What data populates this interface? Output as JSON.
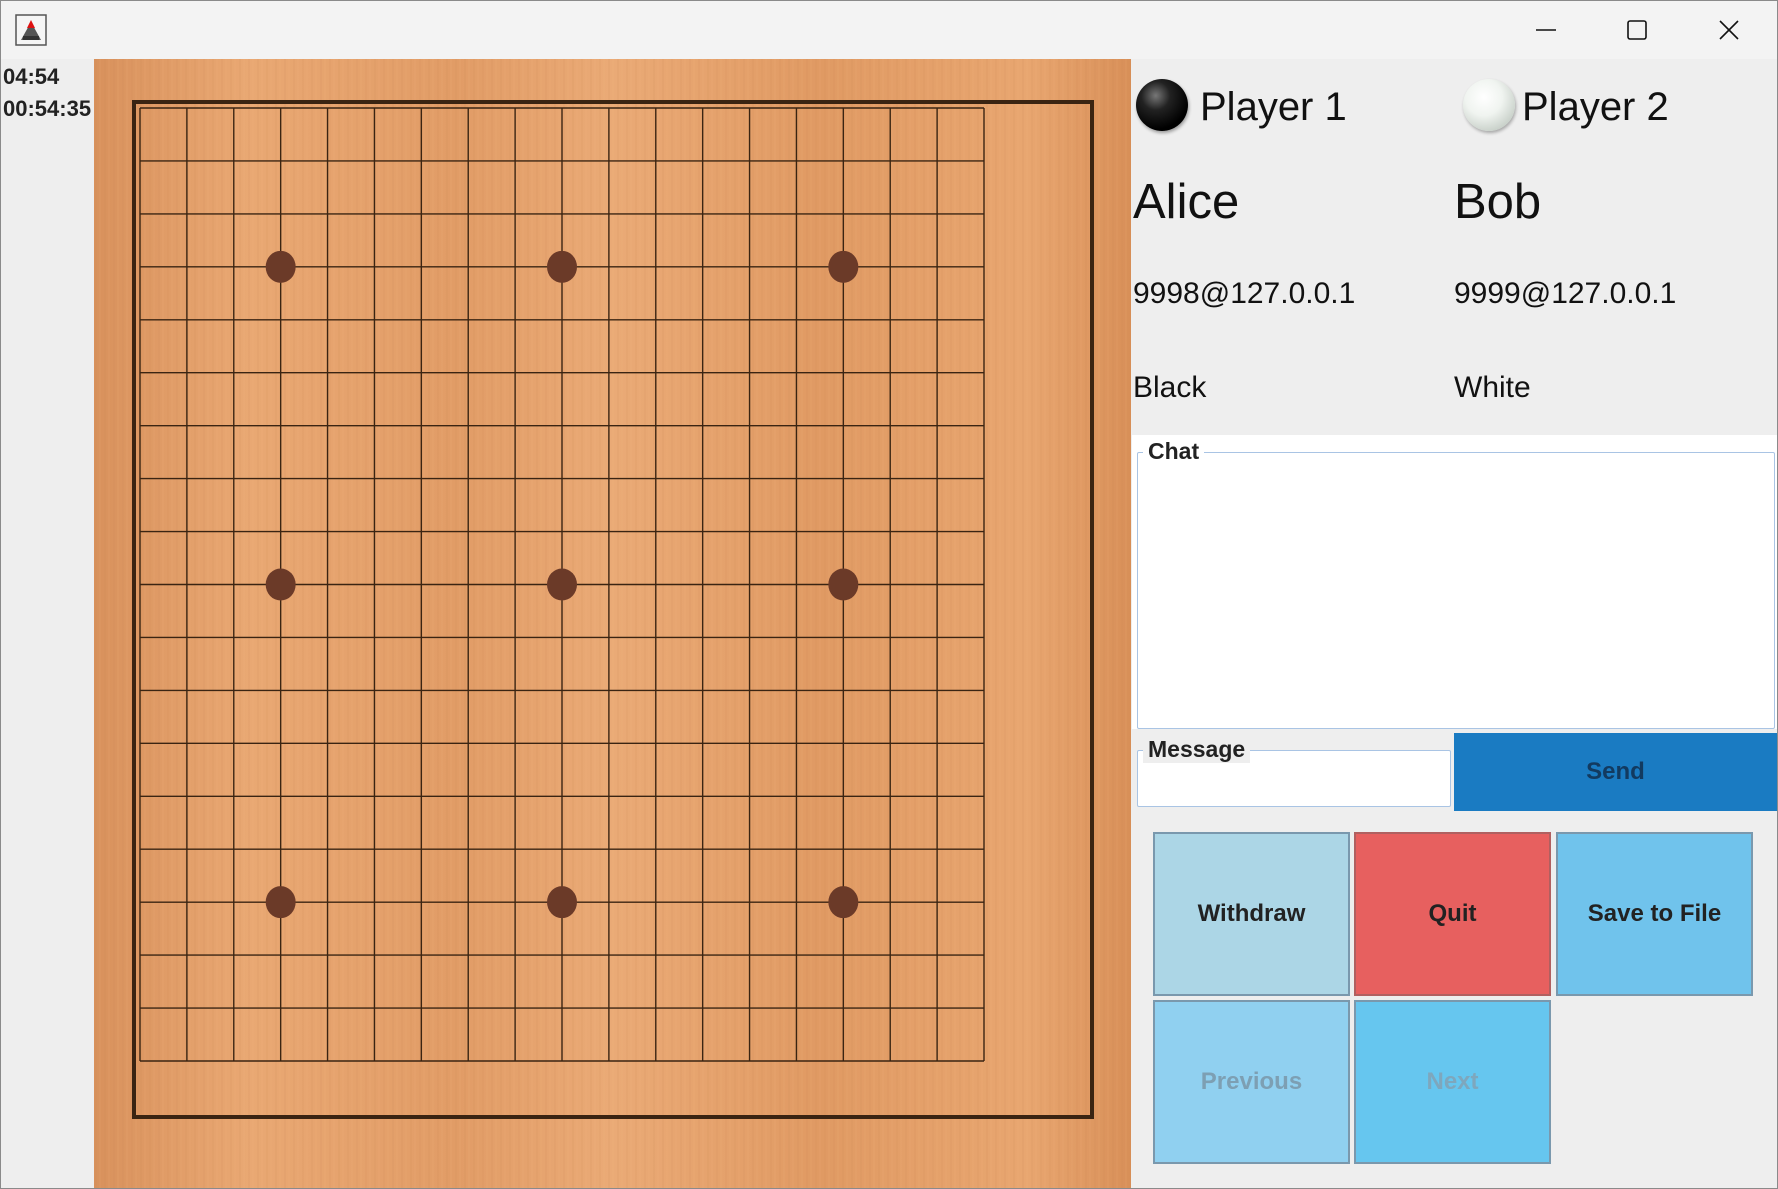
{
  "timers": {
    "move_time": "04:54",
    "total_time": "00:54:35"
  },
  "window_controls": {
    "minimize_icon": "minimize-icon",
    "maximize_icon": "maximize-icon",
    "close_icon": "close-icon",
    "app_icon": "java-app-icon"
  },
  "board": {
    "size": 19,
    "star_points": [
      [
        3,
        3
      ],
      [
        3,
        9
      ],
      [
        3,
        15
      ],
      [
        9,
        3
      ],
      [
        9,
        9
      ],
      [
        9,
        15
      ],
      [
        15,
        3
      ],
      [
        15,
        9
      ],
      [
        15,
        15
      ]
    ],
    "stones": [],
    "colors": {
      "wood": "#e5a26c",
      "line": "#3a2412",
      "star": "#6b3a28"
    }
  },
  "players": {
    "player1": {
      "label": "Player 1",
      "name": "Alice",
      "address": "9998@127.0.0.1",
      "color": "Black"
    },
    "player2": {
      "label": "Player 2",
      "name": "Bob",
      "address": "9999@127.0.0.1",
      "color": "White"
    }
  },
  "chat": {
    "title": "Chat",
    "messages": []
  },
  "message": {
    "title": "Message",
    "value": "",
    "send_label": "Send"
  },
  "buttons": {
    "withdraw": "Withdraw",
    "quit": "Quit",
    "save": "Save to File",
    "previous": "Previous",
    "next": "Next"
  },
  "accent_colors": {
    "send": "#1a7bc2",
    "quit": "#e7605f",
    "save": "#70c3ec",
    "withdraw": "#acd6e6"
  }
}
